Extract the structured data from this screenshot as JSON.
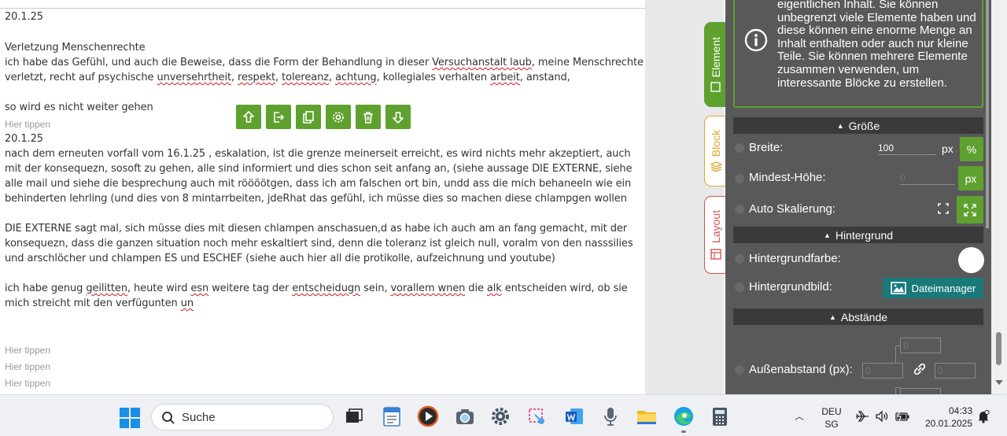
{
  "editor": {
    "lines": [
      {
        "text": "20.1.25"
      },
      {
        "text": "Verletzung Menschenrechte"
      },
      {
        "parts": [
          "ich habe das Gefühl, und auch die Beweise, dass die Form der Behandlung in dieser ",
          "Versuchanstalt laub",
          ", meine Menschrechte"
        ]
      },
      {
        "parts": [
          "verletzt, recht auf psychische ",
          "unversehrtheit",
          ", ",
          "respekt",
          ", ",
          "tolereanz",
          ", ",
          "achtung",
          ", kollegiales verhalten ",
          "arbeit",
          ", anstand,"
        ]
      },
      {
        "text": "so wird es nicht weiter gehen"
      },
      {
        "text": "20.1.25"
      },
      {
        "text": "nach dem erneuten vorfall vom 16.1.25 , eskalation, ist die grenze meinerseit erreicht, es wird nichts mehr akzeptiert, auch"
      },
      {
        "text": "mit der konsequezn, sosoft zu gehen, alle sind informiert und dies schon seit anfang an, (siehe aussage  DIE EXTERNE, siehe"
      },
      {
        "text": "alle mail und siehe die besprechung auch mit röööötgen, dass ich am falschen ort bin, undd ass die mich behaneeln wie ein"
      },
      {
        "text": "behinderten lehrling (und dies von 8 mintarrbeiten, jdeRhat das gefühl, ich müsse dies so machen diese chlampgen wollen"
      },
      {
        "text": "DIE EXTERNE sagt mal, sich müsse dies mit diesen chlampen anschasuen,d as habe ich auch am an fang gemacht, mit der"
      },
      {
        "text": "konsequezn, dass die ganzen situation noch mehr eskaltiert sind, denn die toleranz ist gleich null, voralm von den nasssilies"
      },
      {
        "text": "und arschlöcher und chlampen ES und ESCHEF (siehe auch hier all die protikolle, aufzeichnung und youtube)"
      },
      {
        "parts": [
          "ich habe genug ",
          "geilitten",
          ", heute wird ",
          "esn",
          " weitere tag der ",
          "entscheidugn",
          " sein, ",
          "vorallem wnen",
          " die ",
          "alk",
          " entscheiden wird, ob sie"
        ]
      },
      {
        "parts": [
          "mich streicht mit den verfügunten ",
          "un"
        ]
      }
    ],
    "hint": "Hier tippen"
  },
  "tabs": {
    "element": "Element",
    "block": "Block",
    "layout": "Layout"
  },
  "panel": {
    "info_text": "eigentlichen Inhalt. Sie können unbegrenzt viele Elemente haben und diese können eine enorme Menge an Inhalt enthalten oder auch nur kleine Teile. Sie können mehrere Elemente zusammen verwenden, um interessante Blöcke zu erstellen.",
    "sections": {
      "size": "Größe",
      "background": "Hintergrund",
      "spacing": "Abstände"
    },
    "width_label": "Breite:",
    "width_value": "100",
    "width_unit": "px",
    "percent_label": "%",
    "minheight_label": "Mindest-Höhe:",
    "minheight_placeholder": "0",
    "minheight_unit": "px",
    "autoscale_label": "Auto Skalierung:",
    "bgcolor_label": "Hintergrundfarbe:",
    "bgimage_label": "Hintergrundbild:",
    "file_manager": "Dateimanager",
    "margin_label": "Außenabstand (px):",
    "margin_top_placeholder": "0",
    "margin_left_placeholder": "0",
    "margin_right_placeholder": "0"
  },
  "taskbar": {
    "search_label": "Suche",
    "lang_top": "DEU",
    "lang_bottom": "SG",
    "time": "04:33",
    "date": "20.01.2025"
  },
  "colors": {
    "accent_green": "#5fa12f",
    "block_orange": "#e0a52a",
    "layout_red": "#d9534f",
    "panel_bg": "#595959",
    "section_bar": "#3a3a3a",
    "file_button": "#1a7a7a"
  }
}
